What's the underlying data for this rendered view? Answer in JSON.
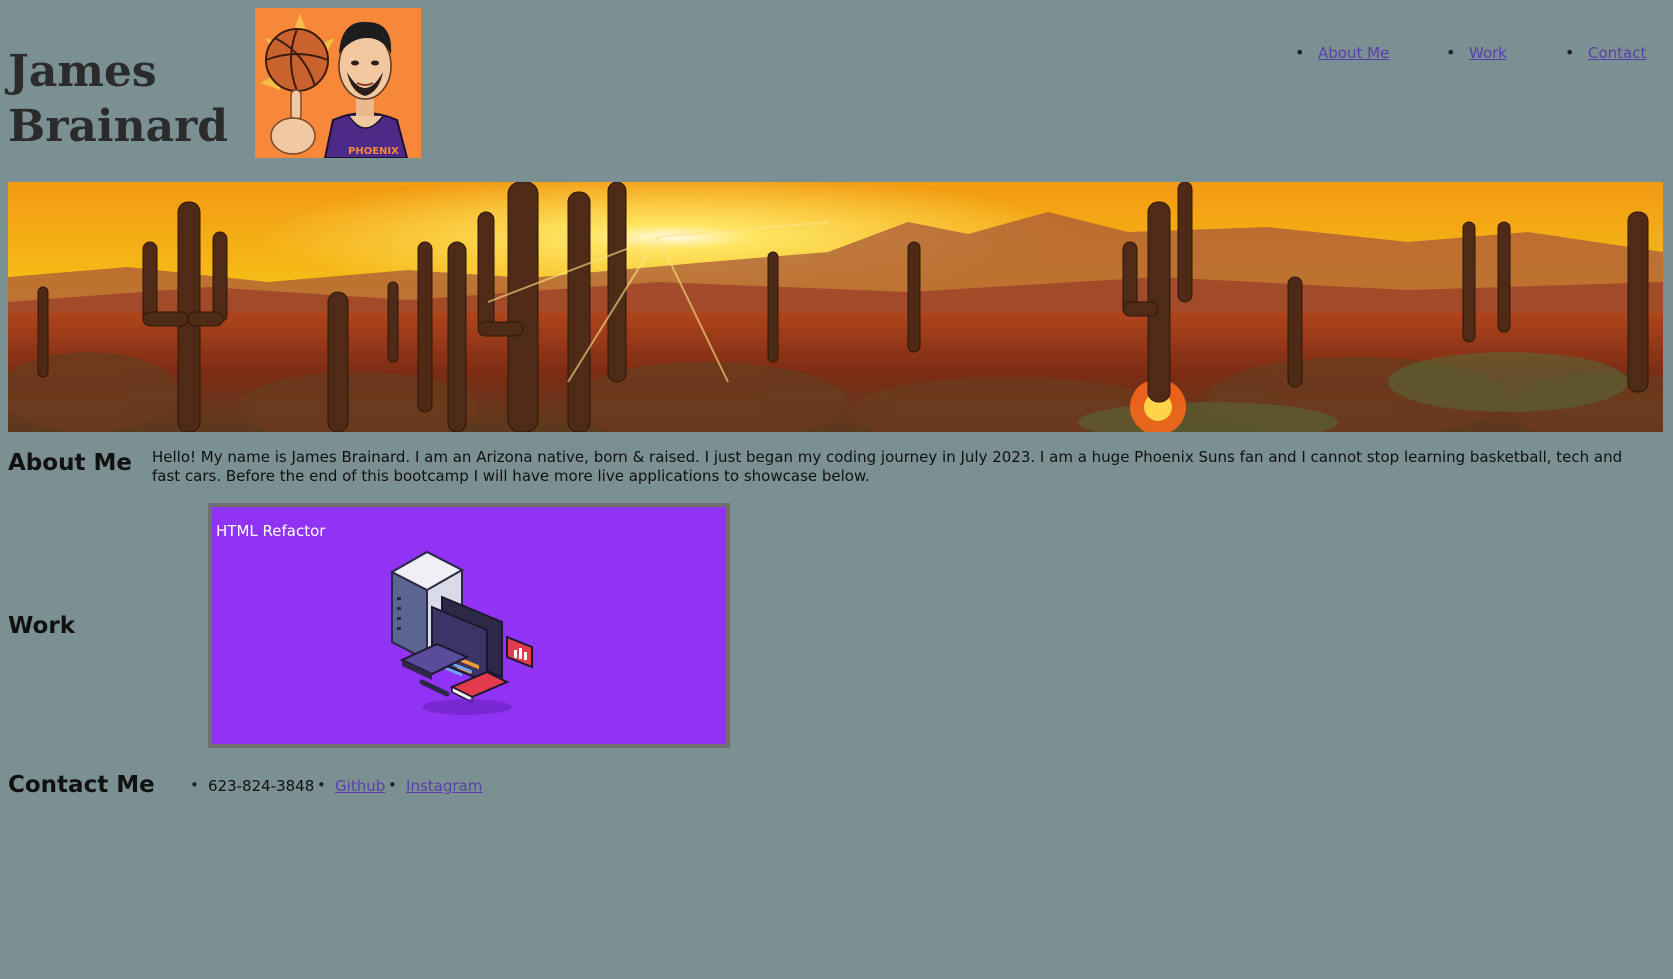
{
  "header": {
    "name_line1": "James",
    "name_line2": "Brainard",
    "avatar_icon": "cartoon-basketball-player-avatar",
    "jersey_text": "PHOENIX"
  },
  "nav": {
    "items": [
      {
        "label": "About Me"
      },
      {
        "label": "Work"
      },
      {
        "label": "Contact"
      }
    ]
  },
  "hero": {
    "image_icon": "desert-sunset-saguaro-banner"
  },
  "about": {
    "heading": "About Me",
    "text": "Hello! My name is James Brainard. I am an Arizona native, born & raised. I just began my coding journey in July 2023. I am a huge Phoenix Suns fan and I cannot stop learning basketball, tech and fast cars. Before the end of this bootcamp I will have more live applications to showcase below."
  },
  "work": {
    "heading": "Work",
    "projects": [
      {
        "label": "HTML Refactor",
        "image_icon": "isometric-computer-workstation-icon"
      }
    ]
  },
  "contact": {
    "heading": "Contact Me",
    "items": [
      {
        "label": "623-824-3848"
      },
      {
        "label": "Github"
      },
      {
        "label": "Instagram"
      }
    ]
  },
  "colors": {
    "page_background": "#7b9092",
    "link": "#5b3fa8",
    "work_card_background": "#9133f5",
    "avatar_background": "#f7883a"
  }
}
